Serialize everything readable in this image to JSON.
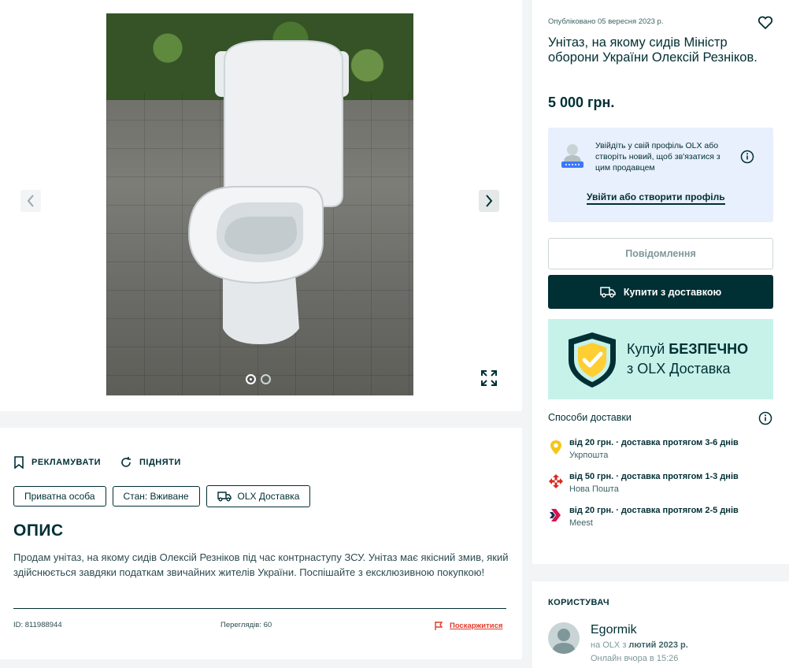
{
  "gallery": {
    "image_alt": "Унітаз",
    "slide_count": 2,
    "active_slide": 1
  },
  "actions": {
    "promote_label": "РЕКЛАМУВАТИ",
    "raise_label": "ПІДНЯТИ"
  },
  "tags": [
    "Приватна особа",
    "Стан: Вживане",
    "OLX Доставка"
  ],
  "description": {
    "heading": "ОПИС",
    "text": "Продам унітаз, на якому сидів Олексій Резніков під час контрнаступу ЗСУ. Унітаз має якісний змив, який здійснюється завдяки податкам звичайних жителів України. Поспішайте з ексклюзивною покупкою!"
  },
  "meta": {
    "id_label": "ID: 811988944",
    "views_label": "Переглядів: 60",
    "report_label": "Поскаржитися"
  },
  "listing": {
    "published": "Опубліковано 05 вересня 2023 р.",
    "title": "Унітаз, на якому сидів Міністр оборони України Олексій Резніков.",
    "price": "5 000 грн."
  },
  "login_prompt": {
    "text": "Увійдіть у свій профіль OLX або створіть новий, щоб зв'язатися з цим продавцем",
    "link": "Увійти або створити профіль"
  },
  "buttons": {
    "message": "Повідомлення",
    "buy": "Купити з доставкою"
  },
  "promo": {
    "line1_prefix": "Купуй ",
    "line1_bold": "БЕЗПЕЧНО",
    "line2": "з OLX Доставка"
  },
  "delivery": {
    "title": "Способи доставки",
    "options": [
      {
        "main": "від 20 грн. · доставка протягом 3-6 днів",
        "carrier": "Укрпошта",
        "icon": "ukrposhta-icon",
        "color": "#f5c518"
      },
      {
        "main": "від 50 грн. · доставка протягом 1-3 днів",
        "carrier": "Нова Пошта",
        "icon": "nova-poshta-icon",
        "color": "#d9291c"
      },
      {
        "main": "від 20 грн. · доставка протягом 2-5 днів",
        "carrier": "Meest",
        "icon": "meest-icon",
        "color": "#d9134b"
      }
    ]
  },
  "user": {
    "heading": "КОРИСТУВАЧ",
    "name": "Egormik",
    "since_prefix": "на OLX з ",
    "since_value": "лютий 2023 р.",
    "online": "Онлайн вчора в 15:26"
  },
  "colors": {
    "brand_dark": "#002f34",
    "report_red": "#e23a2c",
    "login_box_bg": "#e8effd",
    "promo_bg": "#c7f2ea"
  }
}
